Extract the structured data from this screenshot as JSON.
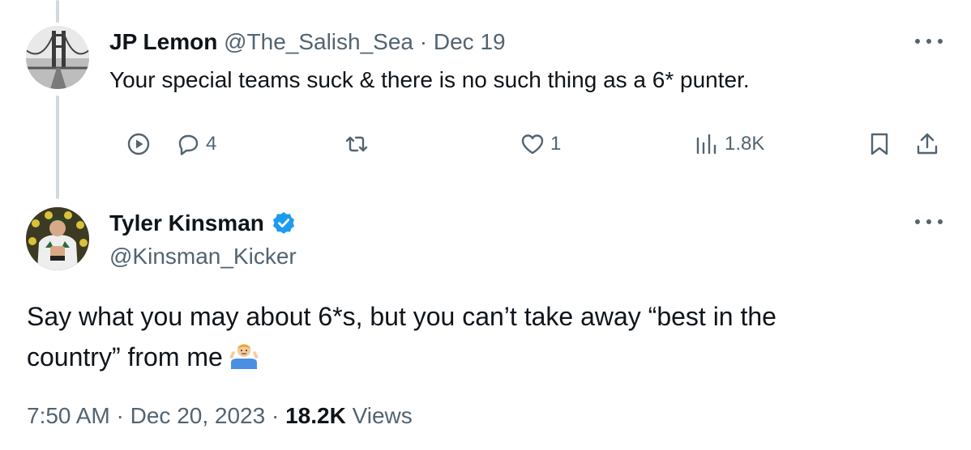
{
  "reply": {
    "display_name": "JP Lemon",
    "handle": "@The_Salish_Sea",
    "separator": "·",
    "date": "Dec 19",
    "text": "Your special teams suck & there is no such thing as a 6* punter.",
    "avatar_icon": "bridge-photo",
    "actions": {
      "replies": "4",
      "likes": "1",
      "views": "1.8K"
    }
  },
  "tweet": {
    "display_name": "Tyler Kinsman",
    "handle": "@Kinsman_Kicker",
    "verified": true,
    "avatar_icon": "football-player-photo",
    "text_line1": "Say what you may about 6*s, but you can’t take away “best in the",
    "text_line2": "country” from me",
    "emoji": "person-shrugging",
    "time": "7:50 AM",
    "separator": "·",
    "date": "Dec 20, 2023",
    "views_count": "18.2K",
    "views_label": "Views"
  },
  "colors": {
    "text": "#0f1419",
    "muted": "#536471",
    "verified": "#1d9bf0",
    "thread_line": "#cfd9de"
  }
}
